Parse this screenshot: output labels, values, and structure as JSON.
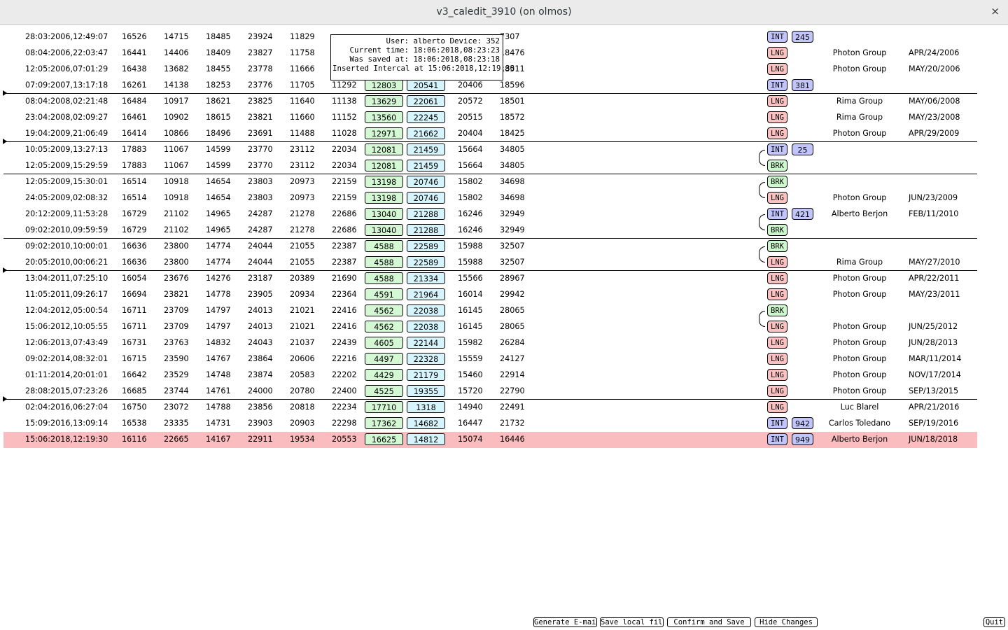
{
  "window": {
    "title": "v3_caledit_3910 (on olmos)",
    "close": "×"
  },
  "tooltip": {
    "lines": [
      "User: alberto Device: 352",
      "Current time: 18:06:2018,08:23:23",
      "Was saved at: 18:06:2018,08:23:18",
      "Inserted Intercal at 15:06:2018,12:19:30"
    ]
  },
  "rows": [
    {
      "ts": "28:03:2006,12:49:07",
      "n1": "16526",
      "n2": "14715",
      "n3": "18485",
      "n4": "23924",
      "n5": "11829",
      "n6": "",
      "g": "",
      "b": "",
      "n9": "",
      "n10": "7307",
      "tag": "INT",
      "num": "245",
      "group": "",
      "date": ""
    },
    {
      "ts": "08:04:2006,22:03:47",
      "n1": "16441",
      "n2": "14406",
      "n3": "18409",
      "n4": "23827",
      "n5": "11758",
      "n6": "",
      "g": "",
      "b": "",
      "n9": "",
      "n10": "18476",
      "tag": "LNG",
      "num": "",
      "group": "Photon Group",
      "date": "APR/24/2006"
    },
    {
      "ts": "12:05:2006,07:01:29",
      "n1": "16438",
      "n2": "13682",
      "n3": "18455",
      "n4": "23778",
      "n5": "11666",
      "n6": "",
      "g": "",
      "b": "",
      "n9": "",
      "n10": "18511",
      "tag": "LNG",
      "num": "",
      "group": "Photon Group",
      "date": "MAY/20/2006"
    },
    {
      "ts": "07:09:2007,13:17:18",
      "n1": "16261",
      "n2": "14138",
      "n3": "18253",
      "n4": "23776",
      "n5": "11705",
      "n6": "11292",
      "g": "12803",
      "b": "20541",
      "n9": "20406",
      "n10": "18596",
      "tag": "INT",
      "num": "381",
      "group": "",
      "date": ""
    },
    {
      "ts": "08:04:2008,02:21:48",
      "n1": "16484",
      "n2": "10917",
      "n3": "18621",
      "n4": "23825",
      "n5": "11640",
      "n6": "11138",
      "g": "13629",
      "b": "22061",
      "n9": "20572",
      "n10": "18501",
      "tag": "LNG",
      "num": "",
      "group": "Rima Group",
      "date": "MAY/06/2008"
    },
    {
      "ts": "23:04:2008,02:09:27",
      "n1": "16461",
      "n2": "10902",
      "n3": "18615",
      "n4": "23821",
      "n5": "11660",
      "n6": "11152",
      "g": "13560",
      "b": "22245",
      "n9": "20515",
      "n10": "18572",
      "tag": "LNG",
      "num": "",
      "group": "Rima Group",
      "date": "MAY/23/2008"
    },
    {
      "ts": "19:04:2009,21:06:49",
      "n1": "16414",
      "n2": "10866",
      "n3": "18496",
      "n4": "23691",
      "n5": "11488",
      "n6": "11028",
      "g": "12971",
      "b": "21662",
      "n9": "20404",
      "n10": "18425",
      "tag": "LNG",
      "num": "",
      "group": "Photon Group",
      "date": "APR/29/2009"
    },
    {
      "ts": "10:05:2009,13:27:13",
      "n1": "17883",
      "n2": "11067",
      "n3": "14599",
      "n4": "23770",
      "n5": "23112",
      "n6": "22034",
      "g": "12081",
      "b": "21459",
      "n9": "15664",
      "n10": "34805",
      "tag": "INT",
      "num": "25",
      "group": "",
      "date": ""
    },
    {
      "ts": "12:05:2009,15:29:59",
      "n1": "17883",
      "n2": "11067",
      "n3": "14599",
      "n4": "23770",
      "n5": "23112",
      "n6": "22034",
      "g": "12081",
      "b": "21459",
      "n9": "15664",
      "n10": "34805",
      "tag": "BRK",
      "num": "",
      "group": "",
      "date": ""
    },
    {
      "ts": "12:05:2009,15:30:01",
      "n1": "16514",
      "n2": "10918",
      "n3": "14654",
      "n4": "23803",
      "n5": "20973",
      "n6": "22159",
      "g": "13198",
      "b": "20746",
      "n9": "15802",
      "n10": "34698",
      "tag": "BRK",
      "num": "",
      "group": "",
      "date": ""
    },
    {
      "ts": "24:05:2009,02:08:32",
      "n1": "16514",
      "n2": "10918",
      "n3": "14654",
      "n4": "23803",
      "n5": "20973",
      "n6": "22159",
      "g": "13198",
      "b": "20746",
      "n9": "15802",
      "n10": "34698",
      "tag": "LNG",
      "num": "",
      "group": "Photon Group",
      "date": "JUN/23/2009"
    },
    {
      "ts": "20:12:2009,11:53:28",
      "n1": "16729",
      "n2": "21102",
      "n3": "14965",
      "n4": "24287",
      "n5": "21278",
      "n6": "22686",
      "g": "13040",
      "b": "21288",
      "n9": "16246",
      "n10": "32949",
      "tag": "INT",
      "num": "421",
      "group": "Alberto Berjon",
      "date": "FEB/11/2010"
    },
    {
      "ts": "09:02:2010,09:59:59",
      "n1": "16729",
      "n2": "21102",
      "n3": "14965",
      "n4": "24287",
      "n5": "21278",
      "n6": "22686",
      "g": "13040",
      "b": "21288",
      "n9": "16246",
      "n10": "32949",
      "tag": "BRK",
      "num": "",
      "group": "",
      "date": ""
    },
    {
      "ts": "09:02:2010,10:00:01",
      "n1": "16636",
      "n2": "23800",
      "n3": "14774",
      "n4": "24044",
      "n5": "21055",
      "n6": "22387",
      "g": "4588",
      "b": "22589",
      "n9": "15988",
      "n10": "32507",
      "tag": "BRK",
      "num": "",
      "group": "",
      "date": ""
    },
    {
      "ts": "20:05:2010,00:06:21",
      "n1": "16636",
      "n2": "23800",
      "n3": "14774",
      "n4": "24044",
      "n5": "21055",
      "n6": "22387",
      "g": "4588",
      "b": "22589",
      "n9": "15988",
      "n10": "32507",
      "tag": "LNG",
      "num": "",
      "group": "Rima Group",
      "date": "MAY/27/2010"
    },
    {
      "ts": "13:04:2011,07:25:10",
      "n1": "16054",
      "n2": "23676",
      "n3": "14276",
      "n4": "23187",
      "n5": "20389",
      "n6": "21690",
      "g": "4588",
      "b": "21334",
      "n9": "15566",
      "n10": "28967",
      "tag": "LNG",
      "num": "",
      "group": "Photon Group",
      "date": "APR/22/2011"
    },
    {
      "ts": "11:05:2011,09:26:17",
      "n1": "16694",
      "n2": "23821",
      "n3": "14778",
      "n4": "23905",
      "n5": "20934",
      "n6": "22364",
      "g": "4591",
      "b": "21964",
      "n9": "16014",
      "n10": "29942",
      "tag": "LNG",
      "num": "",
      "group": "Photon Group",
      "date": "MAY/23/2011"
    },
    {
      "ts": "12:04:2012,05:00:54",
      "n1": "16711",
      "n2": "23709",
      "n3": "14797",
      "n4": "24013",
      "n5": "21021",
      "n6": "22416",
      "g": "4562",
      "b": "22038",
      "n9": "16145",
      "n10": "28065",
      "tag": "BRK",
      "num": "",
      "group": "",
      "date": ""
    },
    {
      "ts": "15:06:2012,10:05:55",
      "n1": "16711",
      "n2": "23709",
      "n3": "14797",
      "n4": "24013",
      "n5": "21021",
      "n6": "22416",
      "g": "4562",
      "b": "22038",
      "n9": "16145",
      "n10": "28065",
      "tag": "LNG",
      "num": "",
      "group": "Photon Group",
      "date": "JUN/25/2012"
    },
    {
      "ts": "12:06:2013,07:43:49",
      "n1": "16731",
      "n2": "23763",
      "n3": "14832",
      "n4": "24043",
      "n5": "21037",
      "n6": "22439",
      "g": "4605",
      "b": "22144",
      "n9": "15982",
      "n10": "26284",
      "tag": "LNG",
      "num": "",
      "group": "Photon Group",
      "date": "JUN/28/2013"
    },
    {
      "ts": "09:02:2014,08:32:01",
      "n1": "16715",
      "n2": "23590",
      "n3": "14767",
      "n4": "23864",
      "n5": "20606",
      "n6": "22216",
      "g": "4497",
      "b": "22328",
      "n9": "15559",
      "n10": "24127",
      "tag": "LNG",
      "num": "",
      "group": "Photon Group",
      "date": "MAR/11/2014"
    },
    {
      "ts": "01:11:2014,20:01:01",
      "n1": "16642",
      "n2": "23529",
      "n3": "14748",
      "n4": "23874",
      "n5": "20583",
      "n6": "22202",
      "g": "4429",
      "b": "21179",
      "n9": "15460",
      "n10": "22914",
      "tag": "LNG",
      "num": "",
      "group": "Photon Group",
      "date": "NOV/17/2014"
    },
    {
      "ts": "28:08:2015,07:23:26",
      "n1": "16685",
      "n2": "23744",
      "n3": "14761",
      "n4": "24000",
      "n5": "20780",
      "n6": "22400",
      "g": "4525",
      "b": "19355",
      "n9": "15720",
      "n10": "22790",
      "tag": "LNG",
      "num": "",
      "group": "Photon Group",
      "date": "SEP/13/2015"
    },
    {
      "ts": "02:04:2016,06:27:04",
      "n1": "16750",
      "n2": "23072",
      "n3": "14788",
      "n4": "23856",
      "n5": "20818",
      "n6": "22234",
      "g": "17710",
      "b": "1318",
      "n9": "14940",
      "n10": "22491",
      "tag": "LNG",
      "num": "",
      "group": "Luc Blarel",
      "date": "APR/21/2016"
    },
    {
      "ts": "15:09:2016,13:09:14",
      "n1": "16538",
      "n2": "23335",
      "n3": "14731",
      "n4": "23903",
      "n5": "20903",
      "n6": "22298",
      "g": "17362",
      "b": "14682",
      "n9": "16447",
      "n10": "21732",
      "tag": "INT",
      "num": "942",
      "group": "Carlos Toledano",
      "date": "SEP/19/2016"
    },
    {
      "ts": "15:06:2018,12:19:30",
      "n1": "16116",
      "n2": "22665",
      "n3": "14167",
      "n4": "22911",
      "n5": "19534",
      "n6": "20553",
      "g": "16625",
      "b": "14812",
      "n9": "15074",
      "n10": "16446",
      "tag": "INT",
      "num": "949",
      "group": "Alberto Berjon",
      "date": "JUN/18/2018"
    }
  ],
  "buttons": {
    "generate_email": "Generate E-mail",
    "save_local": "Save local file",
    "confirm_save": "Confirm and Save",
    "hide_changes": "Hide Changes",
    "quit": "Quit"
  },
  "colors": {
    "highlight_row": "#fbbcbf",
    "int_tag": "#c2c5fb",
    "lng_tag": "#fcc1c1",
    "brk_tag": "#cdf7cd",
    "green_box": "#d4f7d4",
    "blue_box": "#d5f4fb"
  }
}
